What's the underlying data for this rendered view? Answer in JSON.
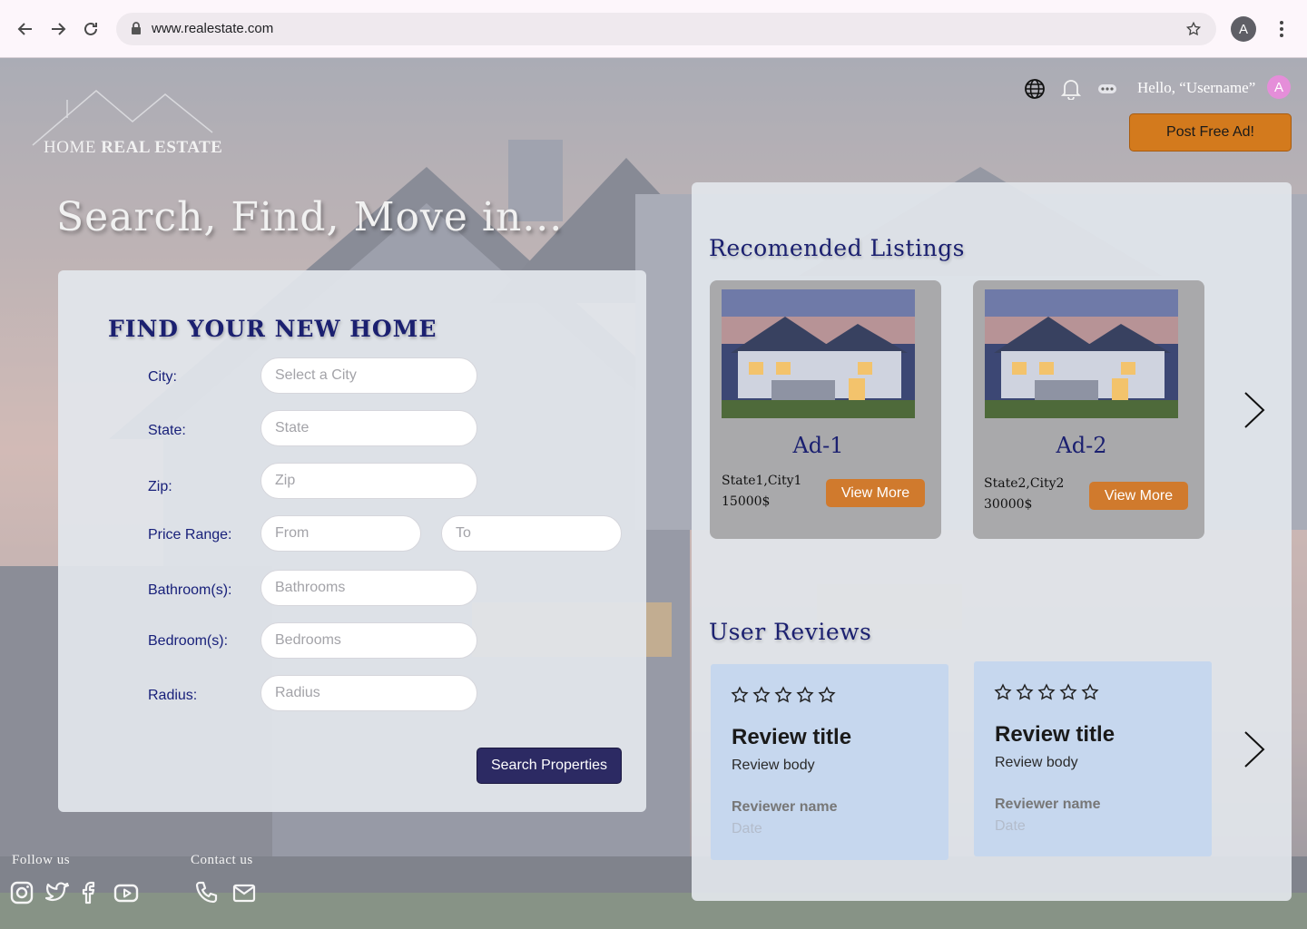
{
  "browser": {
    "url": "www.realestate.com",
    "profile_initial": "A"
  },
  "logo": {
    "word1": "HOME",
    "word2": "REAL ESTATE"
  },
  "header": {
    "greeting": "Hello, “Username”",
    "avatar_initial": "A",
    "post_ad_label": "Post Free Ad!"
  },
  "hero": {
    "tagline": "Search, Find, Move in..."
  },
  "search": {
    "title": "FIND YOUR NEW HOME",
    "city_label": "City:",
    "city_placeholder": "Select a City",
    "state_label": "State:",
    "state_placeholder": "State",
    "zip_label": "Zip:",
    "zip_placeholder": "Zip",
    "price_label": "Price Range:",
    "price_from_placeholder": "From",
    "price_to_placeholder": "To",
    "bath_label": "Bathroom(s):",
    "bath_placeholder": "Bathrooms",
    "bed_label": "Bedroom(s):",
    "bed_placeholder": "Bedrooms",
    "radius_label": "Radius:",
    "radius_placeholder": "Radius",
    "submit_label": "Search Properties"
  },
  "listings": {
    "title": "Recomended Listings",
    "items": [
      {
        "title": "Ad-1",
        "location": "State1,City1",
        "price": "15000$",
        "button": "View More"
      },
      {
        "title": "Ad-2",
        "location": "State2,City2",
        "price": "30000$",
        "button": "View More"
      }
    ]
  },
  "reviews": {
    "title": "User Reviews",
    "items": [
      {
        "stars": 0,
        "title": "Review title",
        "body": "Review body",
        "name": "Reviewer name",
        "date": "Date"
      },
      {
        "stars": 0,
        "title": "Review title",
        "body": "Review body",
        "name": "Reviewer name",
        "date": "Date"
      }
    ]
  },
  "footer": {
    "follow_label": "Follow us",
    "contact_label": "Contact us",
    "social_icons": [
      "instagram-icon",
      "twitter-icon",
      "facebook-icon",
      "youtube-icon"
    ],
    "contact_icons": [
      "phone-icon",
      "mail-icon"
    ]
  },
  "colors": {
    "brand_navy": "#1b2070",
    "accent_orange": "#d37a1d",
    "search_button": "#2c2a63",
    "review_card": "#c6d7ee"
  }
}
